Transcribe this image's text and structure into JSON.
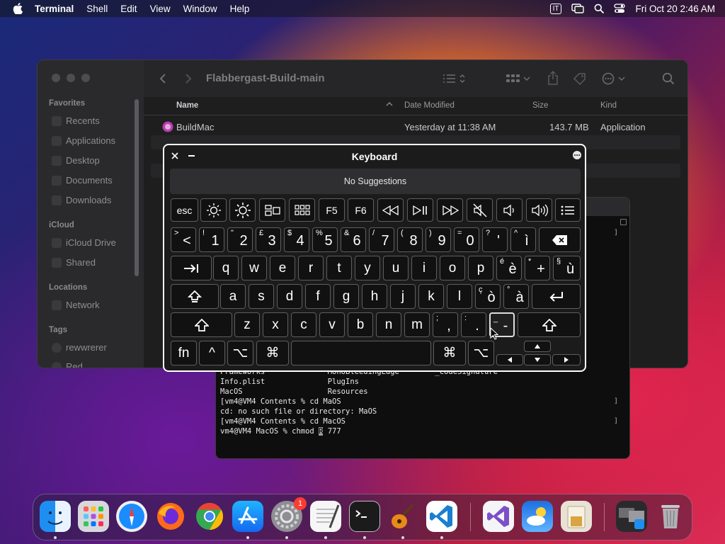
{
  "menubar": {
    "app_name": "Terminal",
    "menus": [
      "Shell",
      "Edit",
      "View",
      "Window",
      "Help"
    ],
    "input_source": "IT",
    "clock": "Fri Oct 20  2:46 AM"
  },
  "finder": {
    "title": "Flabbergast-Build-main",
    "sidebar": {
      "favorites_label": "Favorites",
      "favorites": [
        "Recents",
        "Applications",
        "Desktop",
        "Documents",
        "Downloads"
      ],
      "icloud_label": "iCloud",
      "icloud": [
        "iCloud Drive",
        "Shared"
      ],
      "locations_label": "Locations",
      "locations": [
        "Network"
      ],
      "tags_label": "Tags",
      "tags": [
        "rewwrerer",
        "Red"
      ]
    },
    "columns": {
      "name": "Name",
      "date": "Date Modified",
      "size": "Size",
      "kind": "Kind"
    },
    "rows": [
      {
        "name": "BuildMac",
        "date": "Yesterday at 11:38 AM",
        "size": "143.7 MB",
        "kind": "Application"
      }
    ]
  },
  "terminal": {
    "lines": [
      "Frameworks              MonoBleedingEdge        _CodeSignature",
      "Info.plist              PlugIns",
      "MacOS                   Resources",
      "[vm4@VM4 Contents % cd MaOS",
      "cd: no such file or directory: MaOS",
      "[vm4@VM4 Contents % cd MacOS",
      "vm4@VM4 MacOS % chmod "
    ],
    "cursor_char": "R",
    "line_tail": " 777"
  },
  "keyboard": {
    "title": "Keyboard",
    "suggestions": "No Suggestions",
    "fn_row": [
      "esc",
      "F5",
      "F6"
    ],
    "number_row": [
      {
        "s": ">",
        "m": "<"
      },
      {
        "s": "!",
        "m": "1"
      },
      {
        "s": "\"",
        "m": "2"
      },
      {
        "s": "£",
        "m": "3"
      },
      {
        "s": "$",
        "m": "4"
      },
      {
        "s": "%",
        "m": "5"
      },
      {
        "s": "&",
        "m": "6"
      },
      {
        "s": "/",
        "m": "7"
      },
      {
        "s": "(",
        "m": "8"
      },
      {
        "s": ")",
        "m": "9"
      },
      {
        "s": "=",
        "m": "0"
      },
      {
        "s": "?",
        "m": "'"
      },
      {
        "s": "^",
        "m": "ì"
      }
    ],
    "row_q": [
      "q",
      "w",
      "e",
      "r",
      "t",
      "y",
      "u",
      "i",
      "o",
      "p"
    ],
    "row_q_extra": [
      {
        "s": "é",
        "m": "è"
      },
      {
        "s": "*",
        "m": "+"
      },
      {
        "s": "§",
        "m": "ù"
      }
    ],
    "row_a": [
      "a",
      "s",
      "d",
      "f",
      "g",
      "h",
      "j",
      "k",
      "l"
    ],
    "row_a_extra": [
      {
        "s": "ç",
        "m": "ò"
      },
      {
        "s": "°",
        "m": "à"
      }
    ],
    "row_z": [
      "z",
      "x",
      "c",
      "v",
      "b",
      "n",
      "m"
    ],
    "row_z_extra": [
      {
        "s": ";",
        "m": ","
      },
      {
        "s": ":",
        "m": "."
      },
      {
        "s": "_",
        "m": "-"
      }
    ],
    "bottom": {
      "fn": "fn",
      "ctrl": "^",
      "opt": "⌥",
      "cmd": "⌘"
    }
  },
  "dock": {
    "settings_badge": "1"
  }
}
